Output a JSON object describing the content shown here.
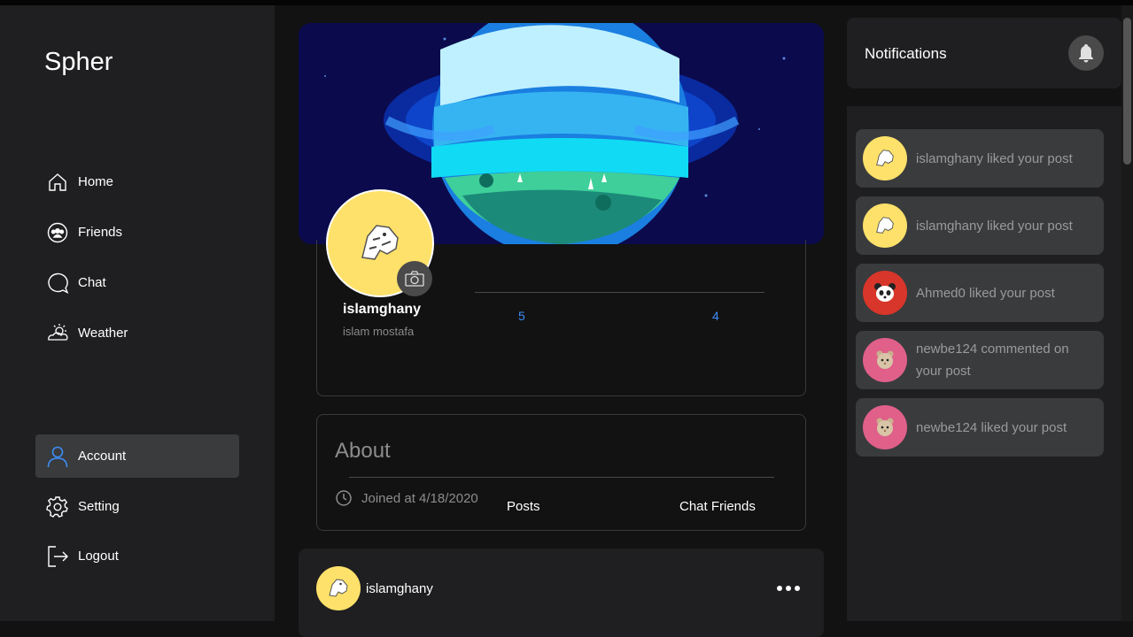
{
  "app": {
    "brand": "Spher"
  },
  "sidebar": {
    "items": [
      {
        "label": "Home",
        "icon": "home-icon"
      },
      {
        "label": "Friends",
        "icon": "friends-icon"
      },
      {
        "label": "Chat",
        "icon": "chat-icon"
      },
      {
        "label": "Weather",
        "icon": "weather-icon"
      }
    ],
    "bottom_items": [
      {
        "label": "Account",
        "icon": "user-icon",
        "active": true
      },
      {
        "label": "Setting",
        "icon": "gear-icon"
      },
      {
        "label": "Logout",
        "icon": "logout-icon"
      }
    ]
  },
  "profile": {
    "username": "islamghany",
    "full_name": "islam mostafa",
    "stats": [
      {
        "label": "Posts",
        "value": "5"
      },
      {
        "label": "Chat Friends",
        "value": "4"
      }
    ]
  },
  "about": {
    "title": "About",
    "joined": "Joined at 4/18/2020"
  },
  "post": {
    "author": "islamghany"
  },
  "notifications": {
    "title": "Notifications",
    "items": [
      {
        "text": "islamghany liked your post",
        "avatar_color": "#fde16a"
      },
      {
        "text": "islamghany liked your post",
        "avatar_color": "#fde16a"
      },
      {
        "text": "Ahmed0 liked your post",
        "avatar_color": "#d8362a"
      },
      {
        "text": "newbe124 commented on your post",
        "avatar_color": "#e0608a"
      },
      {
        "text": "newbe124 liked your post",
        "avatar_color": "#e0608a"
      }
    ]
  },
  "colors": {
    "accent": "#3e8ef7",
    "sidebar_bg": "#1f1f21",
    "active_item": "#3a3b3d"
  }
}
